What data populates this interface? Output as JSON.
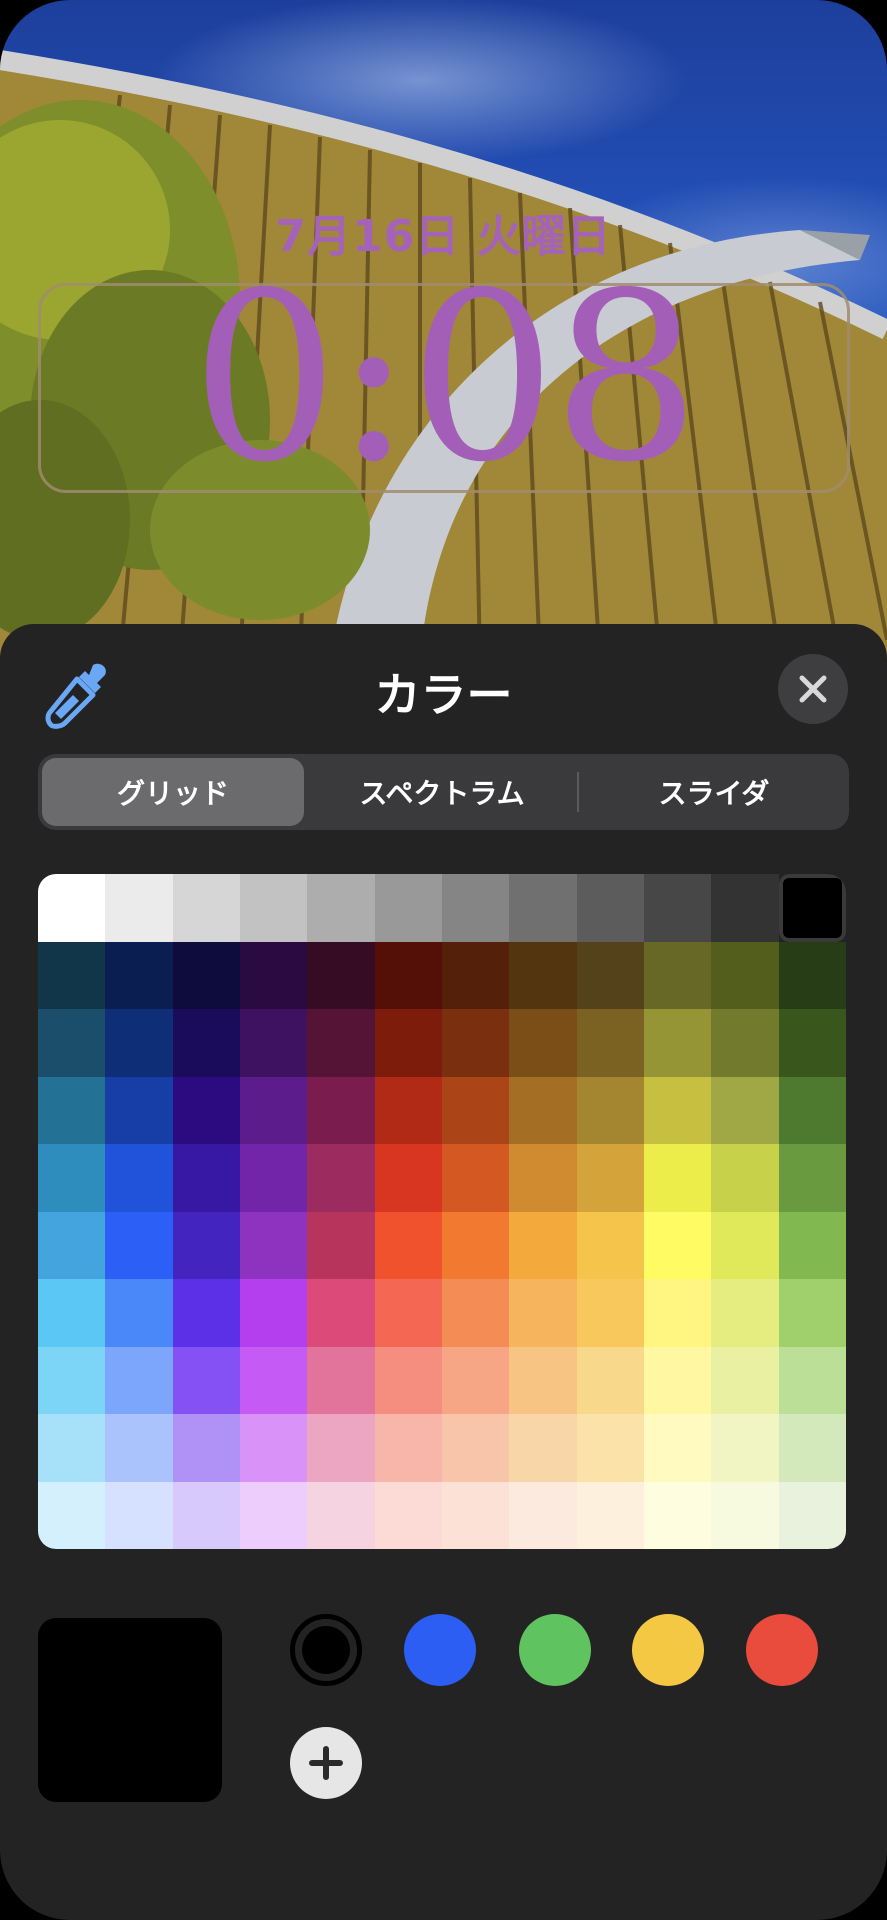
{
  "lock_screen": {
    "date": "7月16日 火曜日",
    "time": "0:08"
  },
  "color_picker": {
    "title": "カラー",
    "icons": {
      "eyedropper": "eyedropper-icon",
      "close": "close-icon",
      "add": "plus-icon"
    },
    "tabs": [
      {
        "label": "グリッド",
        "active": true
      },
      {
        "label": "スペクトラム",
        "active": false
      },
      {
        "label": "スライダ",
        "active": false
      }
    ],
    "grid_rows": [
      [
        "#ffffff",
        "#ebebeb",
        "#d6d6d6",
        "#c2c2c2",
        "#adadad",
        "#999999",
        "#858585",
        "#707070",
        "#5c5c5c",
        "#474747",
        "#333333",
        "#000000"
      ],
      [
        "#11364a",
        "#0a1e52",
        "#0e0b3d",
        "#2a0a41",
        "#360b24",
        "#541007",
        "#55200a",
        "#533510",
        "#53421a",
        "#676826",
        "#545e1c",
        "#263d16"
      ],
      [
        "#1a4e6b",
        "#0e2e78",
        "#1a0c5a",
        "#3f1261",
        "#551435",
        "#7e1c0c",
        "#7a300e",
        "#7b4e17",
        "#7b6223",
        "#969535",
        "#717a2d",
        "#39571d"
      ],
      [
        "#237195",
        "#173da7",
        "#2c0b80",
        "#5c1c8c",
        "#7a1d4e",
        "#b02a16",
        "#ab4416",
        "#a56e25",
        "#a48630",
        "#c6bf3f",
        "#a0a845",
        "#4e7a30"
      ],
      [
        "#2e8dbd",
        "#2053d9",
        "#3718a4",
        "#7225a8",
        "#9c2b60",
        "#d83620",
        "#d35822",
        "#d08a30",
        "#d4a43a",
        "#ecec4a",
        "#c8d14a",
        "#6a9a40"
      ],
      [
        "#43a4de",
        "#2c5ff6",
        "#4324be",
        "#8e33c0",
        "#b7355c",
        "#f1522e",
        "#f27a30",
        "#f4a93c",
        "#f5c44b",
        "#fffb62",
        "#dfe95a",
        "#82b850"
      ],
      [
        "#5bc7f5",
        "#4a88fa",
        "#5b30e6",
        "#b43fef",
        "#dc4a7a",
        "#f46853",
        "#f48c56",
        "#f6b45c",
        "#f8c85c",
        "#fff580",
        "#e5ec80",
        "#9fd06c"
      ],
      [
        "#7cd4f7",
        "#7ca5fc",
        "#8651f4",
        "#c65af5",
        "#e2749c",
        "#f68e80",
        "#f6a684",
        "#f8c484",
        "#f8d88a",
        "#fff7a2",
        "#e9f0a2",
        "#bbdf96"
      ],
      [
        "#a7e1f9",
        "#aac3fd",
        "#b092f7",
        "#d892f8",
        "#eca6c2",
        "#f8b5aa",
        "#f8c5aa",
        "#f9d6a8",
        "#fae2a8",
        "#fffac0",
        "#f1f5c3",
        "#d4e9bb"
      ],
      [
        "#d4f0fc",
        "#d5e1fe",
        "#d7c9fb",
        "#eccdfb",
        "#f5d3e1",
        "#fcdad5",
        "#fce2d6",
        "#fdeade",
        "#fdf0dc",
        "#fffde0",
        "#f8fae0",
        "#e8f2dd"
      ]
    ],
    "selected_cell": {
      "row": 0,
      "col": 11
    },
    "preview_color": "#000000",
    "swatches": [
      {
        "name": "black",
        "color": "#000000",
        "current": true
      },
      {
        "name": "blue",
        "color": "#2c5ef4"
      },
      {
        "name": "green",
        "color": "#5fc35f"
      },
      {
        "name": "yellow",
        "color": "#f4c843"
      },
      {
        "name": "red",
        "color": "#e94b3c"
      }
    ]
  }
}
